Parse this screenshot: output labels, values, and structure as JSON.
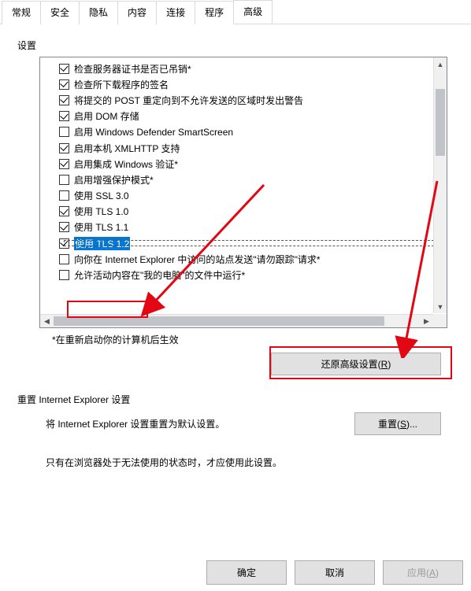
{
  "tabs": [
    {
      "label": "常规",
      "active": false
    },
    {
      "label": "安全",
      "active": false
    },
    {
      "label": "隐私",
      "active": false
    },
    {
      "label": "内容",
      "active": false
    },
    {
      "label": "连接",
      "active": false
    },
    {
      "label": "程序",
      "active": false
    },
    {
      "label": "高级",
      "active": true
    }
  ],
  "settings_label": "设置",
  "items": [
    {
      "checked": true,
      "label": "检查服务器证书是否已吊销*"
    },
    {
      "checked": true,
      "label": "检查所下载程序的签名"
    },
    {
      "checked": true,
      "label": "将提交的 POST 重定向到不允许发送的区域时发出警告"
    },
    {
      "checked": true,
      "label": "启用 DOM 存储"
    },
    {
      "checked": false,
      "label": "启用 Windows Defender SmartScreen"
    },
    {
      "checked": true,
      "label": "启用本机 XMLHTTP 支持"
    },
    {
      "checked": true,
      "label": "启用集成 Windows 验证*"
    },
    {
      "checked": false,
      "label": "启用增强保护模式*"
    },
    {
      "checked": false,
      "label": "使用 SSL 3.0"
    },
    {
      "checked": true,
      "label": "使用 TLS 1.0"
    },
    {
      "checked": true,
      "label": "使用 TLS 1.1"
    },
    {
      "checked": true,
      "label": "使用 TLS 1.2",
      "selected": true
    },
    {
      "checked": false,
      "label": "向你在 Internet Explorer 中访问的站点发送\"请勿跟踪\"请求*"
    },
    {
      "checked": false,
      "label": "允许活动内容在\"我的电脑\"的文件中运行*"
    }
  ],
  "footnote": "*在重新启动你的计算机后生效",
  "restore_button": "还原高级设置(R)",
  "reset_section_label": "重置 Internet Explorer 设置",
  "reset_desc": "将 Internet Explorer 设置重置为默认设置。",
  "reset_button": "重置(S)...",
  "reset_note": "只有在浏览器处于无法使用的状态时，才应使用此设置。",
  "ok_button": "确定",
  "cancel_button": "取消",
  "apply_button": "应用(A)"
}
